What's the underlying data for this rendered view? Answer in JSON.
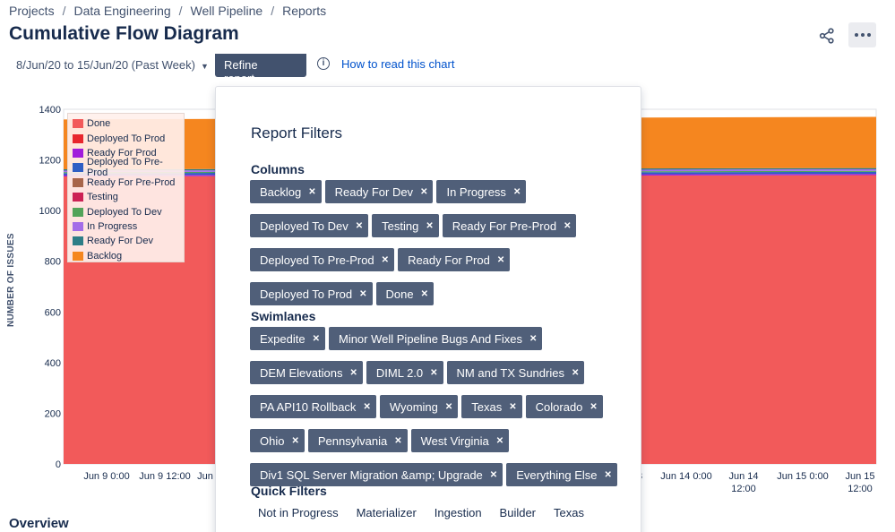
{
  "breadcrumb": [
    "Projects",
    "Data Engineering",
    "Well Pipeline",
    "Reports"
  ],
  "page_title": "Cumulative Flow Diagram",
  "toolbar": {
    "date_range": "8/Jun/20 to 15/Jun/20 (Past Week)",
    "refine_label": "Refine report",
    "how_to_read": "How to read this chart",
    "share_icon": "share-icon",
    "more_icon": "more-icon"
  },
  "chart_data": {
    "type": "area",
    "ylabel": "NUMBER OF ISSUES",
    "ylim": [
      0,
      1400
    ],
    "yticks": [
      0,
      200,
      400,
      600,
      800,
      1000,
      1200,
      1400
    ],
    "xticks": [
      "Jun 9 0:00",
      "Jun 9 12:00",
      "Jun",
      "3",
      "Jun 14 0:00",
      "Jun 14\n12:00",
      "Jun 15 0:00",
      "Jun 15\n12:00"
    ],
    "legend_position": "top-left",
    "series": [
      {
        "name": "Done",
        "color": "#f25a5a",
        "start": 1135,
        "end": 1140
      },
      {
        "name": "Deployed To Prod",
        "color": "#e8272d",
        "start": 0,
        "end": 0
      },
      {
        "name": "Ready For Prod",
        "color": "#a11ddb",
        "start": 5,
        "end": 5
      },
      {
        "name": "Deployed To Pre-Prod",
        "color": "#2f5fc4",
        "start": 8,
        "end": 8
      },
      {
        "name": "Ready For Pre-Prod",
        "color": "#a8654a",
        "start": 0,
        "end": 0
      },
      {
        "name": "Testing",
        "color": "#cc2255",
        "start": 0,
        "end": 0
      },
      {
        "name": "Deployed To Dev",
        "color": "#52a35a",
        "start": 4,
        "end": 4
      },
      {
        "name": "In Progress",
        "color": "#a46de8",
        "start": 6,
        "end": 6
      },
      {
        "name": "Ready For Dev",
        "color": "#2e7d86",
        "start": 5,
        "end": 5
      },
      {
        "name": "Backlog",
        "color": "#f5861f",
        "start": 197,
        "end": 202
      }
    ]
  },
  "filters": {
    "title": "Report Filters",
    "columns_heading": "Columns",
    "columns": [
      "Backlog",
      "Ready For Dev",
      "In Progress",
      "Deployed To Dev",
      "Testing",
      "Ready For Pre-Prod",
      "Deployed To Pre-Prod",
      "Ready For Prod",
      "Deployed To Prod",
      "Done"
    ],
    "swimlanes_heading": "Swimlanes",
    "swimlanes": [
      "Expedite",
      "Minor Well Pipeline Bugs And Fixes",
      "DEM Elevations",
      "DIML 2.0",
      "NM and TX Sundries",
      "PA API10 Rollback",
      "Wyoming",
      "Texas",
      "Colorado",
      "Ohio",
      "Pennsylvania",
      "West Virginia",
      "Div1 SQL Server Migration &amp; Upgrade",
      "Everything Else"
    ],
    "quick_heading": "Quick Filters",
    "quick": [
      "Not in Progress",
      "Materializer",
      "Ingestion",
      "Builder",
      "Texas"
    ]
  },
  "overview_label": "Overview"
}
